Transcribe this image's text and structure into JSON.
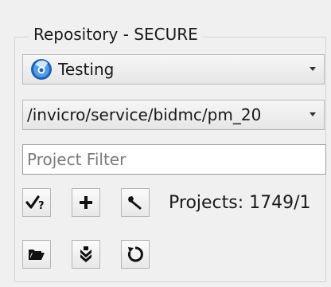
{
  "repository": {
    "group_title": "Repository - SECURE",
    "selected_repo": "Testing",
    "repo_icon": "blue-circular-logo-icon",
    "path": "/invicro/service/bidmc/pm_20"
  },
  "filter": {
    "placeholder": "Project Filter",
    "value": ""
  },
  "toolbar": {
    "row1_icons": [
      "checkmark-question-icon",
      "plus-icon",
      "wrench-icon"
    ],
    "row2_icons": [
      "folder-open-icon",
      "double-chevron-down-icon",
      "refresh-icon"
    ]
  },
  "status": {
    "projects_text": "Projects: 1749/1"
  }
}
